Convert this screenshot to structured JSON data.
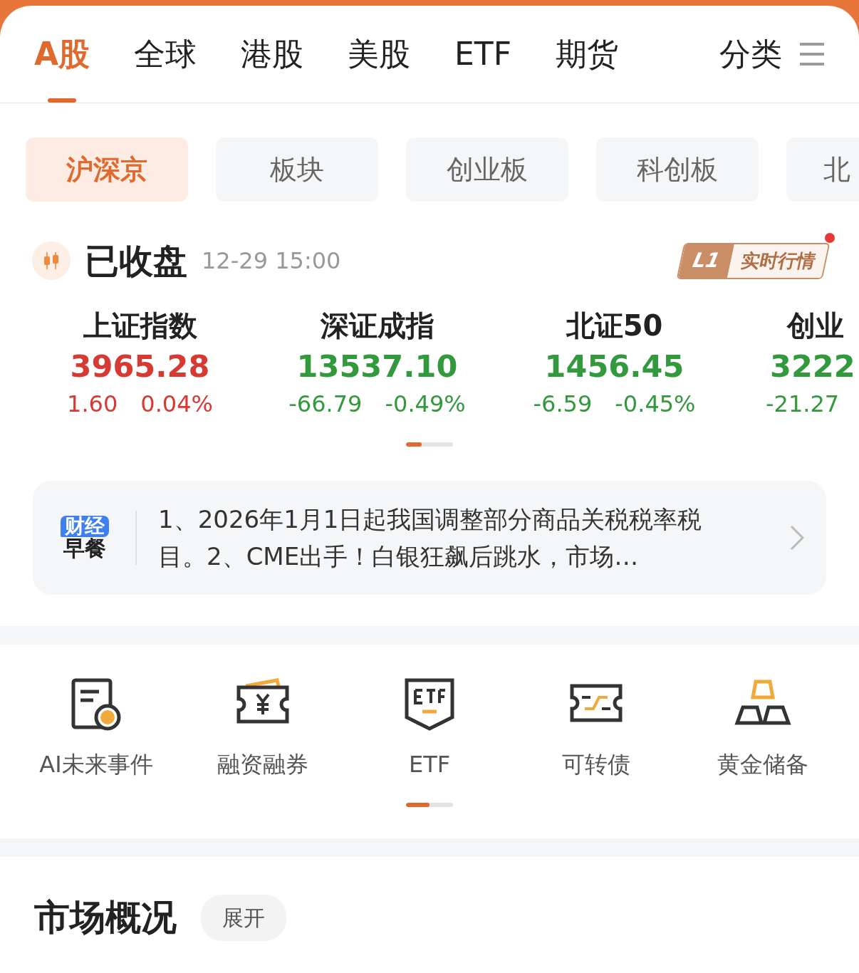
{
  "top_tabs": [
    {
      "label": "A股",
      "selected": true
    },
    {
      "label": "全球",
      "selected": false
    },
    {
      "label": "港股",
      "selected": false
    },
    {
      "label": "美股",
      "selected": false
    },
    {
      "label": "ETF",
      "selected": false
    },
    {
      "label": "期货",
      "selected": false
    }
  ],
  "category_button": {
    "label": "分类"
  },
  "sub_tabs": [
    {
      "label": "沪深京",
      "selected": true
    },
    {
      "label": "板块",
      "selected": false
    },
    {
      "label": "创业板",
      "selected": false
    },
    {
      "label": "科创板",
      "selected": false
    },
    {
      "label": "北",
      "selected": false
    }
  ],
  "market_status": {
    "label": "已收盘",
    "time": "12-29 15:00",
    "badge": {
      "tag": "L1",
      "label": "实时行情",
      "unread": true
    }
  },
  "indices": [
    {
      "name": "上证指数",
      "value": "3965.28",
      "change": "1.60",
      "change_pct": "0.04%",
      "color": "#d63a32"
    },
    {
      "name": "深证成指",
      "value": "13537.10",
      "change": "-66.79",
      "change_pct": "-0.49%",
      "color": "#329a3d"
    },
    {
      "name": "北证50",
      "value": "1456.45",
      "change": "-6.59",
      "change_pct": "-0.45%",
      "color": "#329a3d"
    },
    {
      "name": "创业",
      "value": "3222",
      "change": "-21.27",
      "color": "#329a3d"
    }
  ],
  "indices_pager": {
    "level": 0.33
  },
  "news": {
    "source_top": "财经",
    "source_bottom": "早餐",
    "text": "1、2026年1月1日起我国调整部分商品关税税率税目。2、CME出手！白银狂飙后跳水，市场…"
  },
  "shortcuts": [
    {
      "label": "AI未来事件"
    },
    {
      "label": "融资融券"
    },
    {
      "label": "ETF"
    },
    {
      "label": "可转债"
    },
    {
      "label": "黄金储备"
    }
  ],
  "shortcuts_pager": {
    "level": 0.5
  },
  "section": {
    "title": "市场概况",
    "toggle": "展开"
  }
}
